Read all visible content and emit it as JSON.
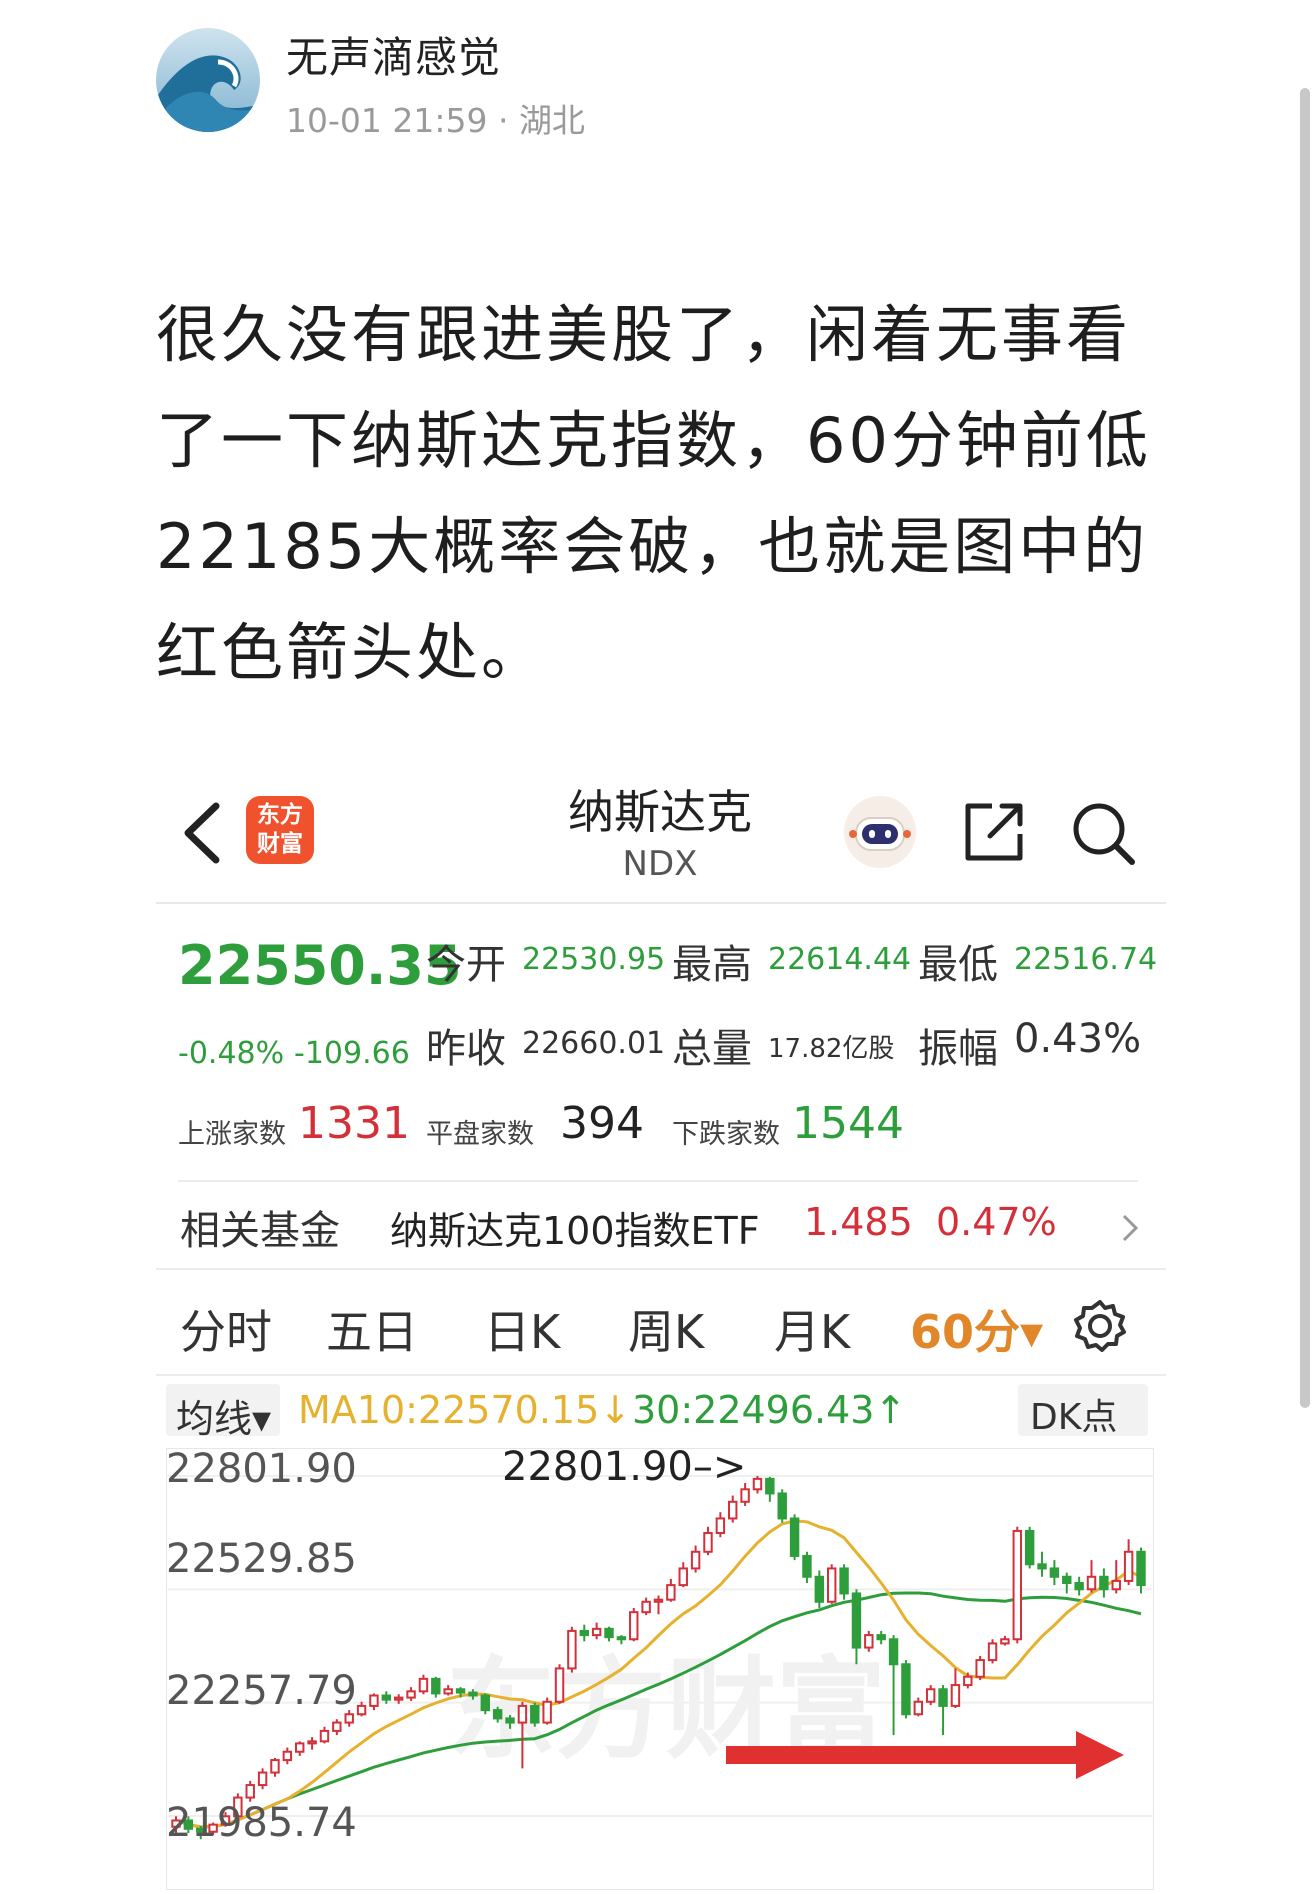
{
  "post": {
    "author": "无声滴感觉",
    "time": "10-01 21:59",
    "location": "· 湖北",
    "text": "很久没有跟进美股了，闲着无事看了一下纳斯达克指数，60分钟前低22185大概率会破，也就是图中的红色箭头处。"
  },
  "app": {
    "title": "纳斯达克",
    "code": "NDX",
    "logo_text": "东方财富"
  },
  "quote": {
    "price": "22550.35",
    "change_pct": "-0.48%",
    "change": "-109.66",
    "open_label": "今开",
    "open": "22530.95",
    "high_label": "最高",
    "high": "22614.44",
    "low_label": "最低",
    "low": "22516.74",
    "prev_label": "昨收",
    "prev": "22660.01",
    "vol_label": "总量",
    "vol": "17.82亿股",
    "amp_label": "振幅",
    "amp": "0.43%",
    "up_label": "上涨家数",
    "up": "1331",
    "flat_label": "平盘家数",
    "flat": "394",
    "down_label": "下跌家数",
    "down": "1544"
  },
  "fund": {
    "label": "相关基金",
    "name": "纳斯达克100指数ETF",
    "price": "1.485",
    "pct": "0.47%"
  },
  "tabs": [
    "分时",
    "五日",
    "日K",
    "周K",
    "月K",
    "60分▾"
  ],
  "ma": {
    "selector": "均线▾",
    "ma10": "MA10:22570.15↓",
    "ma30": "30:22496.43↑",
    "dk": "DK点"
  },
  "chart_data": {
    "type": "candlestick",
    "y_ticks": [
      "22801.90",
      "22529.85",
      "22257.79",
      "21985.74"
    ],
    "max_annotation": "22801.90",
    "watermark": "东方财富",
    "colors": {
      "up": "#d3303a",
      "down": "#2e9e3c",
      "ma10": "#e6b12f",
      "ma30": "#2e9e3c",
      "arrow": "#e03030"
    },
    "candles": [
      [
        21960,
        21975,
        21940,
        21985
      ],
      [
        21975,
        21955,
        21945,
        21985
      ],
      [
        21955,
        21948,
        21930,
        21962
      ],
      [
        21948,
        21965,
        21940,
        21970
      ],
      [
        21965,
        21985,
        21960,
        21995
      ],
      [
        21985,
        22030,
        21980,
        22040
      ],
      [
        22030,
        22060,
        22020,
        22070
      ],
      [
        22060,
        22090,
        22050,
        22100
      ],
      [
        22090,
        22120,
        22080,
        22125
      ],
      [
        22120,
        22140,
        22110,
        22150
      ],
      [
        22140,
        22160,
        22130,
        22165
      ],
      [
        22160,
        22165,
        22145,
        22175
      ],
      [
        22165,
        22190,
        22160,
        22200
      ],
      [
        22190,
        22210,
        22180,
        22218
      ],
      [
        22210,
        22230,
        22200,
        22240
      ],
      [
        22230,
        22250,
        22225,
        22260
      ],
      [
        22250,
        22275,
        22240,
        22280
      ],
      [
        22275,
        22265,
        22255,
        22285
      ],
      [
        22265,
        22270,
        22255,
        22278
      ],
      [
        22270,
        22285,
        22262,
        22295
      ],
      [
        22285,
        22315,
        22278,
        22325
      ],
      [
        22315,
        22280,
        22270,
        22320
      ],
      [
        22280,
        22290,
        22275,
        22300
      ],
      [
        22290,
        22282,
        22270,
        22295
      ],
      [
        22282,
        22275,
        22265,
        22290
      ],
      [
        22275,
        22240,
        22230,
        22280
      ],
      [
        22240,
        22220,
        22210,
        22248
      ],
      [
        22220,
        22210,
        22195,
        22228
      ],
      [
        22210,
        22250,
        22100,
        22260
      ],
      [
        22250,
        22210,
        22200,
        22258
      ],
      [
        22210,
        22260,
        22205,
        22270
      ],
      [
        22260,
        22340,
        22255,
        22350
      ],
      [
        22340,
        22430,
        22330,
        22440
      ],
      [
        22430,
        22420,
        22405,
        22445
      ],
      [
        22420,
        22435,
        22410,
        22450
      ],
      [
        22435,
        22415,
        22405,
        22440
      ],
      [
        22415,
        22410,
        22398,
        22420
      ],
      [
        22410,
        22475,
        22405,
        22485
      ],
      [
        22475,
        22500,
        22468,
        22510
      ],
      [
        22500,
        22505,
        22470,
        22515
      ],
      [
        22505,
        22540,
        22500,
        22555
      ],
      [
        22540,
        22580,
        22535,
        22595
      ],
      [
        22580,
        22620,
        22570,
        22635
      ],
      [
        22620,
        22665,
        22612,
        22680
      ],
      [
        22665,
        22700,
        22655,
        22715
      ],
      [
        22700,
        22740,
        22690,
        22755
      ],
      [
        22740,
        22770,
        22730,
        22785
      ],
      [
        22770,
        22795,
        22760,
        22802
      ],
      [
        22795,
        22760,
        22740,
        22800
      ],
      [
        22760,
        22700,
        22690,
        22770
      ],
      [
        22700,
        22610,
        22600,
        22710
      ],
      [
        22610,
        22560,
        22545,
        22620
      ],
      [
        22560,
        22500,
        22485,
        22575
      ],
      [
        22500,
        22580,
        22495,
        22590
      ],
      [
        22580,
        22520,
        22505,
        22590
      ],
      [
        22520,
        22390,
        22350,
        22530
      ],
      [
        22390,
        22420,
        22380,
        22430
      ],
      [
        22420,
        22410,
        22398,
        22430
      ],
      [
        22410,
        22350,
        22180,
        22420
      ],
      [
        22350,
        22230,
        22220,
        22360
      ],
      [
        22230,
        22260,
        22225,
        22270
      ],
      [
        22260,
        22290,
        22252,
        22300
      ],
      [
        22290,
        22250,
        22180,
        22300
      ],
      [
        22250,
        22300,
        22245,
        22340
      ],
      [
        22300,
        22320,
        22292,
        22330
      ],
      [
        22320,
        22360,
        22312,
        22370
      ],
      [
        22360,
        22400,
        22352,
        22410
      ],
      [
        22400,
        22410,
        22395,
        22418
      ],
      [
        22410,
        22670,
        22400,
        22680
      ],
      [
        22670,
        22590,
        22580,
        22680
      ],
      [
        22590,
        22580,
        22560,
        22620
      ],
      [
        22580,
        22560,
        22540,
        22600
      ],
      [
        22560,
        22545,
        22520,
        22570
      ],
      [
        22545,
        22530,
        22515,
        22560
      ],
      [
        22530,
        22560,
        22522,
        22600
      ],
      [
        22560,
        22530,
        22510,
        22580
      ],
      [
        22530,
        22550,
        22520,
        22600
      ],
      [
        22550,
        22620,
        22540,
        22650
      ],
      [
        22620,
        22540,
        22520,
        22630
      ]
    ]
  }
}
